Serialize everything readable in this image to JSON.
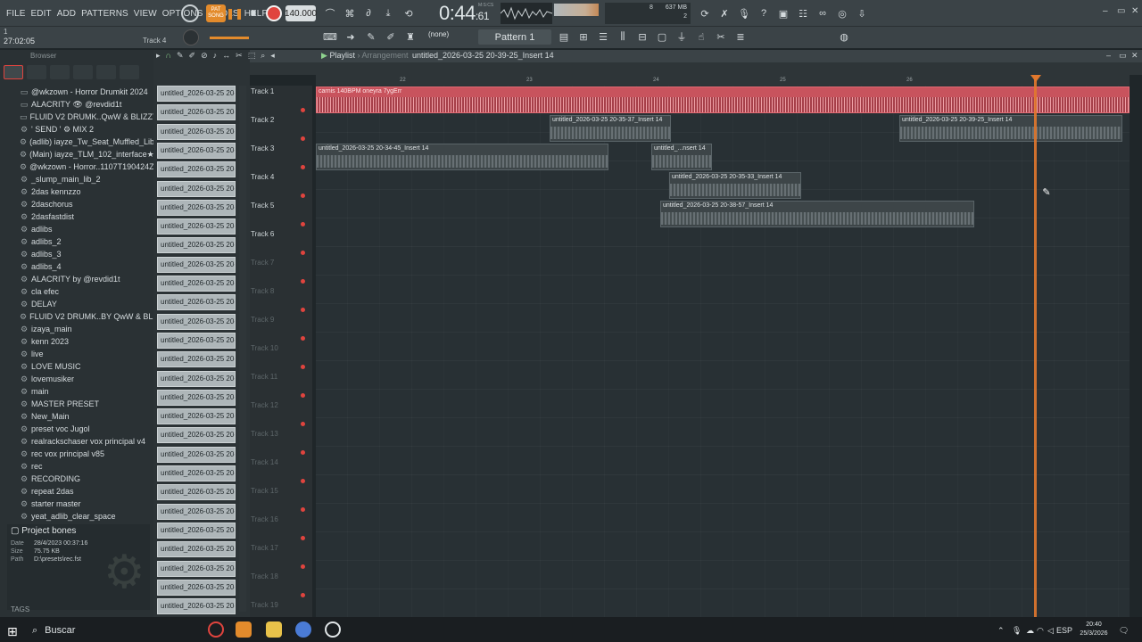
{
  "menu": [
    "FILE",
    "EDIT",
    "ADD",
    "PATTERNS",
    "VIEW",
    "OPTIONS",
    "TOOLS",
    "HELP"
  ],
  "transport": {
    "song_label_top": "PAT",
    "song_label": "SONG",
    "tempo": "140.000",
    "time_main": "0:44",
    "time_sub": "61",
    "time_unit": "M:S:CS",
    "memory": "637 MB",
    "cpu_top": "8",
    "cpu_bottom": "2"
  },
  "hint": {
    "top": "1",
    "time": "27:02:05",
    "track": "Track 4"
  },
  "toolbar2": {
    "none_label": "(none)",
    "pattern": "Pattern 1"
  },
  "browser": {
    "title": "Browser",
    "items": [
      {
        "icon": "folder-icon",
        "label": "@wkzown - Horror Drumkit 2024"
      },
      {
        "icon": "folder-icon",
        "label": "ALACRITY 👁 @revdid1t"
      },
      {
        "icon": "folder-icon",
        "label": "FLUID V2 DRUMK..QwW & BLIZZY®"
      },
      {
        "icon": "gear-icon",
        "label": "' SEND ' ⚙ MIX 2"
      },
      {
        "icon": "gear-icon",
        "label": "(adlib) iayze_Tw_Seat_Muffled_Lib★"
      },
      {
        "icon": "gear-icon",
        "label": "(Main) iayze_TLM_102_interface★"
      },
      {
        "icon": "gear-icon",
        "label": "@wkzown - Horror..1107T190424Z-001"
      },
      {
        "icon": "gear-icon",
        "label": "_slump_main_lib_2"
      },
      {
        "icon": "gear-icon",
        "label": "2das kennzzo"
      },
      {
        "icon": "gear-icon",
        "label": "2daschorus"
      },
      {
        "icon": "gear-icon",
        "label": "2dasfastdist"
      },
      {
        "icon": "gear-icon",
        "label": "adlibs"
      },
      {
        "icon": "gear-icon",
        "label": "adlibs_2"
      },
      {
        "icon": "gear-icon",
        "label": "adlibs_3"
      },
      {
        "icon": "gear-icon",
        "label": "adlibs_4"
      },
      {
        "icon": "gear-icon",
        "label": "ALACRITY by @revdid1t"
      },
      {
        "icon": "gear-icon",
        "label": "cla efec"
      },
      {
        "icon": "gear-icon",
        "label": "DELAY"
      },
      {
        "icon": "gear-icon",
        "label": "FLUID V2 DRUMK..BY QwW & BLIZZY®"
      },
      {
        "icon": "gear-icon",
        "label": "izaya_main"
      },
      {
        "icon": "gear-icon",
        "label": "kenn 2023"
      },
      {
        "icon": "gear-icon",
        "label": "live"
      },
      {
        "icon": "gear-icon",
        "label": "LOVE MUSIC"
      },
      {
        "icon": "gear-icon",
        "label": "lovemusiker"
      },
      {
        "icon": "gear-icon",
        "label": "main"
      },
      {
        "icon": "gear-icon",
        "label": "MASTER PRESET"
      },
      {
        "icon": "gear-icon",
        "label": "New_Main"
      },
      {
        "icon": "gear-icon",
        "label": "preset voc Jugol"
      },
      {
        "icon": "gear-icon",
        "label": "realrackschaser vox principal v4"
      },
      {
        "icon": "gear-icon",
        "label": "rec vox principal v85"
      },
      {
        "icon": "gear-icon",
        "label": "rec"
      },
      {
        "icon": "gear-icon",
        "label": "RECORDING"
      },
      {
        "icon": "gear-icon",
        "label": "repeat 2das"
      },
      {
        "icon": "gear-icon",
        "label": "starter master"
      },
      {
        "icon": "gear-icon",
        "label": "yeat_adlib_clear_space"
      }
    ],
    "project": {
      "title": "Project bones",
      "date_label": "Date",
      "date": "28/4/2023 00:37:16",
      "size_label": "Size",
      "size": "75.75 KB",
      "path_label": "Path",
      "path": "D:\\presets\\rec.fst"
    },
    "tags_label": "TAGS"
  },
  "picker": {
    "item_label": "untitled_2026-03-25 20-...",
    "count": 28
  },
  "playlist": {
    "title": "Playlist",
    "subtitle": "Arrangement",
    "name": "untitled_2026-03-25 20-39-25_Insert 14",
    "ruler": [
      "22",
      "23",
      "24",
      "25",
      "26"
    ],
    "tracks": [
      "Track 1",
      "Track 2",
      "Track 3",
      "Track 4",
      "Track 5",
      "Track 6",
      "Track 7",
      "Track 8",
      "Track 9",
      "Track 10",
      "Track 11",
      "Track 12",
      "Track 13",
      "Track 14",
      "Track 15",
      "Track 16",
      "Track 17",
      "Track 18",
      "Track 19"
    ],
    "clips": [
      {
        "track": 0,
        "label": "carnis 140BPM oneyra 7ygErr",
        "style": "red"
      },
      {
        "track": 1,
        "label": "untitled_2026-03-25 20-35-37_Insert 14",
        "style": "normal"
      },
      {
        "track": 1,
        "label": "untitled_2026-03-25 20-39-25_Insert 14",
        "style": "normal"
      },
      {
        "track": 2,
        "label": "untitled_2026-03-25 20-34-45_Insert 14",
        "style": "normal"
      },
      {
        "track": 2,
        "label": "untitled_...nsert 14",
        "style": "normal"
      },
      {
        "track": 3,
        "label": "untitled_2026-03-25 20-35-33_Insert 14",
        "style": "normal"
      },
      {
        "track": 4,
        "label": "untitled_2026-03-25 20-38-57_Insert 14",
        "style": "normal"
      }
    ]
  },
  "taskbar": {
    "search": "Buscar",
    "lang": "ESP",
    "time": "20:40",
    "date": "25/3/2026"
  }
}
